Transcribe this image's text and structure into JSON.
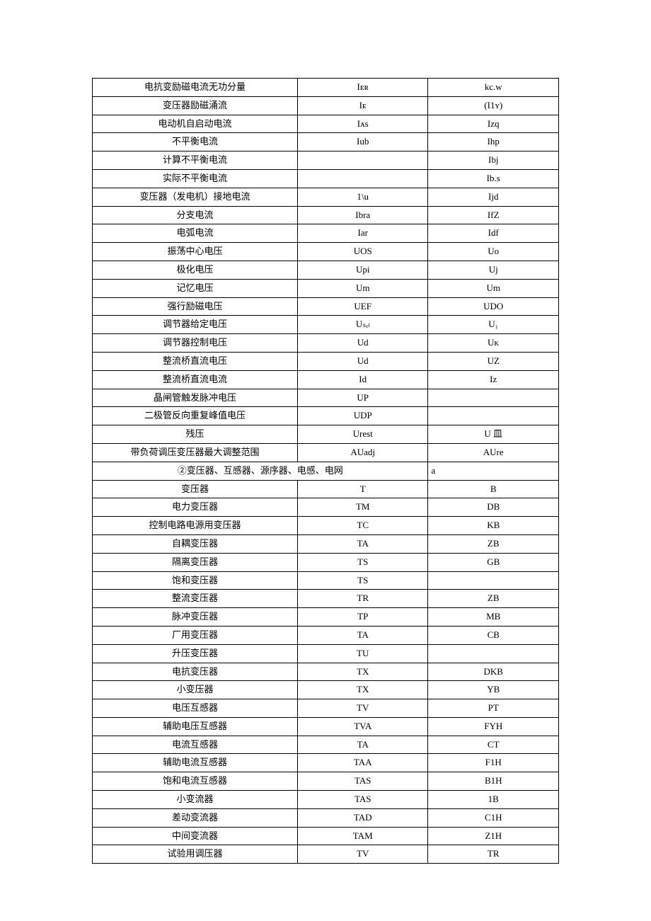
{
  "rows_a": [
    {
      "name": "电抗变励磁电流无功分量",
      "new": "Iᴇʀ",
      "old": "kc.w"
    },
    {
      "name": "变压器励磁涌流",
      "new": "Iᴇ",
      "old": "(I1ʏ)"
    },
    {
      "name": "电动机自启动电流",
      "new": "Iᴀs",
      "old": "Izq"
    },
    {
      "name": "不平衡电流",
      "new": "Iub",
      "old": "Ihp"
    },
    {
      "name": "计算不平衡电流",
      "new": "",
      "old": "Ibj"
    },
    {
      "name": "实际不平衡电流",
      "new": "",
      "old": "Ib.s"
    },
    {
      "name": "变压器（发电机）接地电流",
      "new": "1\\u",
      "old": "Ijd"
    },
    {
      "name": "分支电流",
      "new": "Ibra",
      "old": "IfZ"
    },
    {
      "name": "电弧电流",
      "new": "Iar",
      "old": "Idf"
    },
    {
      "name": "振荡中心电压",
      "new": "UOS",
      "old": "Uo"
    },
    {
      "name": "极化电压",
      "new": "Upi",
      "old": "Uj"
    },
    {
      "name": "记忆电压",
      "new": "Um",
      "old": "Um"
    },
    {
      "name": "强行励磁电压",
      "new": "UEF",
      "old": "UDO"
    },
    {
      "name": "调节器给定电压",
      "new": "Uₛₑₗ",
      "old": "U₁"
    },
    {
      "name": "调节器控制电压",
      "new": "Ud",
      "old": "Uᴋ"
    },
    {
      "name": "整流桥直流电压",
      "new": "Ud",
      "old": "UZ"
    },
    {
      "name": "整流桥直流电流",
      "new": "Id",
      "old": "Iz"
    },
    {
      "name": "晶闸管触发脉冲电压",
      "new": "UP",
      "old": ""
    },
    {
      "name": "二极管反向重复峰值电压",
      "new": "UDP",
      "old": ""
    },
    {
      "name": "残压",
      "new": "Urest",
      "old": "U 皿"
    },
    {
      "name": "带负荷调压变压器最大调整范围",
      "new": "AUadj",
      "old": "AUre"
    }
  ],
  "section_header": {
    "left": "②变压器、互感器、源序器、电感、电网",
    "right": "a"
  },
  "rows_b": [
    {
      "name": "变压器",
      "new": "T",
      "old": "B"
    },
    {
      "name": "电力变压器",
      "new": "TM",
      "old": "DB"
    },
    {
      "name": "控制电路电源用变压器",
      "new": "TC",
      "old": "KB"
    },
    {
      "name": "自耦变压器",
      "new": "TA",
      "old": "ZB"
    },
    {
      "name": "隔离变压器",
      "new": "TS",
      "old": "GB"
    },
    {
      "name": "饱和变压器",
      "new": "TS",
      "old": ""
    },
    {
      "name": "整流变压器",
      "new": "TR",
      "old": "ZB"
    },
    {
      "name": "脉冲变压器",
      "new": "TP",
      "old": "MB"
    },
    {
      "name": "厂用变压器",
      "new": "TA",
      "old": "CB"
    },
    {
      "name": "升压变压器",
      "new": "TU",
      "old": ""
    },
    {
      "name": "电抗变压器",
      "new": "TX",
      "old": "DKB"
    },
    {
      "name": "小变压器",
      "new": "TX",
      "old": "YB"
    },
    {
      "name": "电压互感器",
      "new": "TV",
      "old": "PT"
    },
    {
      "name": "辅助电压互感器",
      "new": "TVA",
      "old": "FYH"
    },
    {
      "name": "电流互感器",
      "new": "TA",
      "old": "CT"
    },
    {
      "name": "辅助电流互感器",
      "new": "TAA",
      "old": "F1H"
    },
    {
      "name": "饱和电流互感器",
      "new": "TAS",
      "old": "B1H"
    },
    {
      "name": "小变流器",
      "new": "TAS",
      "old": "1B"
    },
    {
      "name": "差动变流器",
      "new": "TAD",
      "old": "C1H"
    },
    {
      "name": "中间变流器",
      "new": "TAM",
      "old": "Z1H"
    },
    {
      "name": "试验用调压器",
      "new": "TV",
      "old": "TR"
    }
  ]
}
